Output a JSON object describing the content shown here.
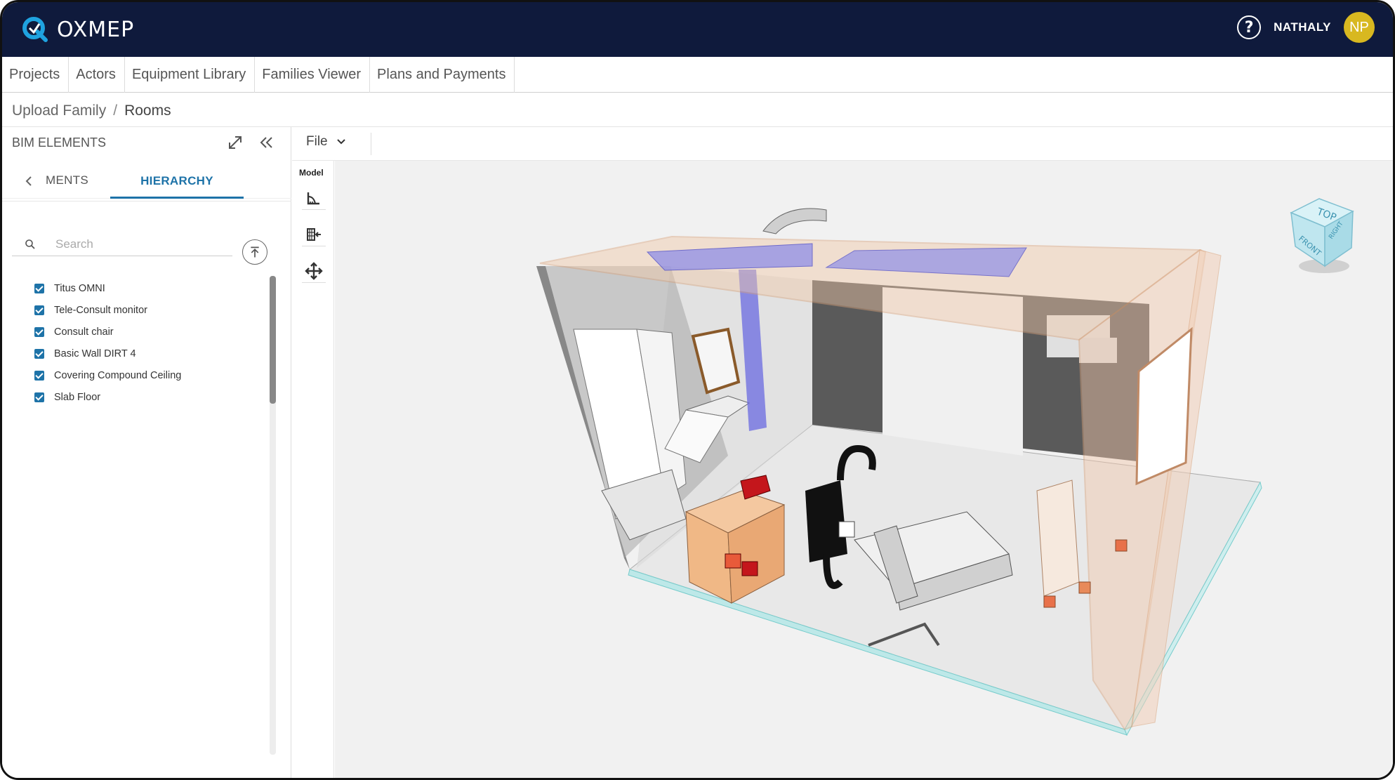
{
  "app": {
    "brand": "OXMEP"
  },
  "user": {
    "name": "NATHALY",
    "initials": "NP"
  },
  "nav": {
    "items": [
      "Projects",
      "Actors",
      "Equipment Library",
      "Families Viewer",
      "Plans and Payments"
    ]
  },
  "breadcrumb": {
    "parent": "Upload Family",
    "separator": "/",
    "current": "Rooms"
  },
  "left_panel": {
    "title": "BIM ELEMENTS",
    "tabs": {
      "prev": "MENTS",
      "active": "HIERARCHY"
    },
    "search": {
      "placeholder": "Search",
      "value": ""
    },
    "tree": [
      {
        "label": "Titus OMNI",
        "checked": true
      },
      {
        "label": "Tele-Consult monitor",
        "checked": true
      },
      {
        "label": "Consult chair",
        "checked": true
      },
      {
        "label": "Basic Wall DIRT  4",
        "checked": true
      },
      {
        "label": "Covering Compound Ceiling",
        "checked": true
      },
      {
        "label": "Slab Floor",
        "checked": true
      }
    ]
  },
  "viewer": {
    "file_menu": "File",
    "tool_title": "Model",
    "tools": [
      "measure-icon",
      "section-icon",
      "pan-icon"
    ],
    "viewcube": {
      "top": "TOP",
      "front": "FRONT",
      "right": "RIGHT"
    }
  },
  "colors": {
    "topbar": "#0f1a3c",
    "accent": "#1e73a8",
    "avatar": "#d8b820"
  }
}
